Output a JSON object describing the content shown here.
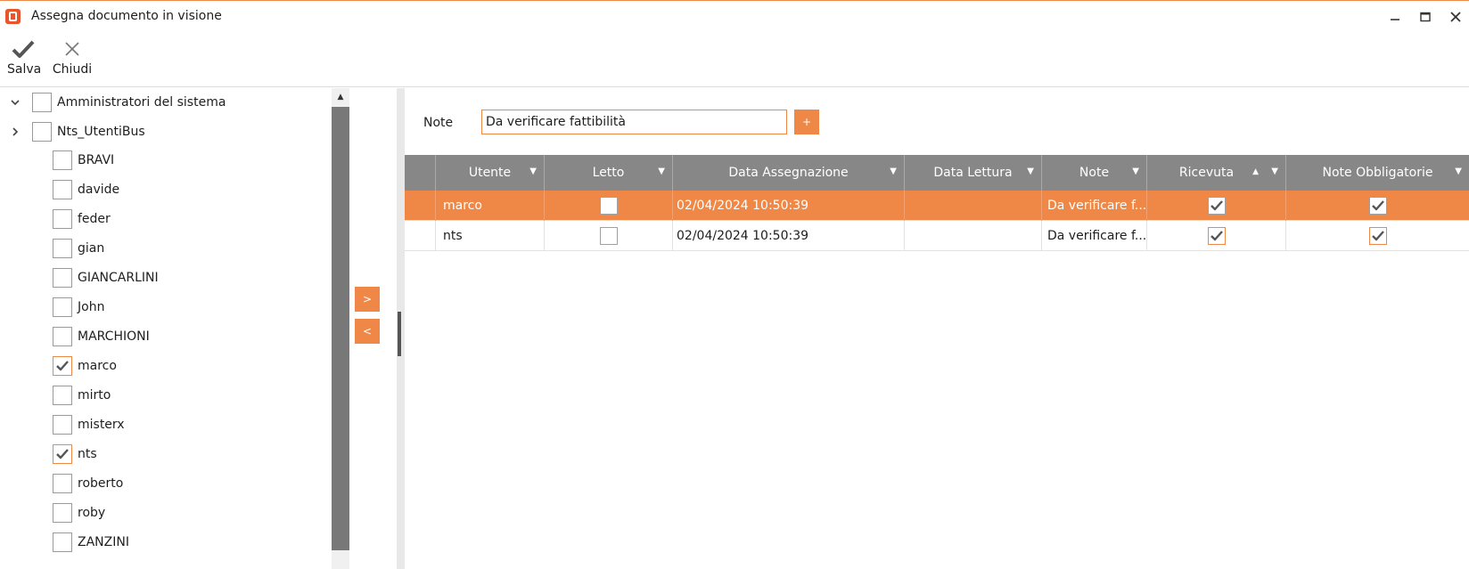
{
  "window": {
    "title": "Assegna documento in visione",
    "controls": [
      "minimize",
      "maximize",
      "close"
    ]
  },
  "toolbar": {
    "save_label": "Salva",
    "close_label": "Chiudi"
  },
  "tree": {
    "groups": [
      {
        "label": "Amministratori del sistema",
        "expanded": true,
        "checked": false
      },
      {
        "label": "Nts_UtentiBus",
        "expanded": false,
        "checked": false
      }
    ],
    "users": [
      {
        "label": "BRAVI",
        "checked": false
      },
      {
        "label": "davide",
        "checked": false
      },
      {
        "label": "feder",
        "checked": false
      },
      {
        "label": "gian",
        "checked": false
      },
      {
        "label": "GIANCARLINI",
        "checked": false
      },
      {
        "label": "John",
        "checked": false
      },
      {
        "label": "MARCHIONI",
        "checked": false
      },
      {
        "label": "marco",
        "checked": true
      },
      {
        "label": "mirto",
        "checked": false
      },
      {
        "label": "misterx",
        "checked": false
      },
      {
        "label": "nts",
        "checked": true
      },
      {
        "label": "roberto",
        "checked": false
      },
      {
        "label": "roby",
        "checked": false
      },
      {
        "label": "ZANZINI",
        "checked": false
      }
    ]
  },
  "move": {
    "add_label": ">",
    "remove_label": "<"
  },
  "note": {
    "label": "Note",
    "value": "Da verificare fattibilità",
    "add_label": "+"
  },
  "grid": {
    "columns": [
      {
        "label": "Utente",
        "filter": true
      },
      {
        "label": "Letto",
        "filter": true
      },
      {
        "label": "Data Assegnazione",
        "filter": true
      },
      {
        "label": "Data Lettura",
        "filter": true
      },
      {
        "label": "Note",
        "filter": true
      },
      {
        "label": "Ricevuta",
        "filter": true,
        "sort": "asc"
      },
      {
        "label": "Note Obbligatorie",
        "filter": true
      }
    ],
    "rows": [
      {
        "utente": "marco",
        "letto": false,
        "data_assegnazione": "02/04/2024 10:50:39",
        "data_lettura": "",
        "note": "Da verificare f...",
        "ricevuta": true,
        "note_obbligatorie": true,
        "selected": true
      },
      {
        "utente": "nts",
        "letto": false,
        "data_assegnazione": "02/04/2024 10:50:39",
        "data_lettura": "",
        "note": "Da verificare f...",
        "ricevuta": true,
        "note_obbligatorie": true,
        "selected": false
      }
    ]
  },
  "colors": {
    "accent": "#ef8846",
    "header_bg": "#878787",
    "app_icon": "#e8552d"
  }
}
